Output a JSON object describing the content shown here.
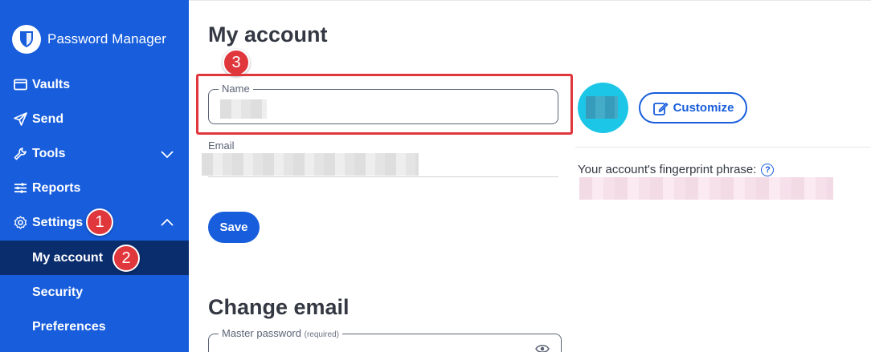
{
  "brand": {
    "name": "Password Manager"
  },
  "nav": {
    "vaults": "Vaults",
    "send": "Send",
    "tools": "Tools",
    "reports": "Reports",
    "settings": "Settings",
    "my_account": "My account",
    "security": "Security",
    "preferences": "Preferences"
  },
  "steps": {
    "one": "1",
    "two": "2",
    "three": "3"
  },
  "main": {
    "title": "My account",
    "name_label": "Name",
    "email_label": "Email",
    "save_label": "Save",
    "customize_label": "Customize",
    "fingerprint_label": "Your account's fingerprint phrase:",
    "help_glyph": "?",
    "change_email_title": "Change email",
    "master_password_label": "Master password",
    "required_label": "(required)"
  },
  "colors": {
    "sidebar": "#175ddc",
    "active_nav": "#0a2d6e",
    "accent": "#175ddc",
    "annotation": "#e0373d",
    "avatar": "#1cc6e6"
  }
}
